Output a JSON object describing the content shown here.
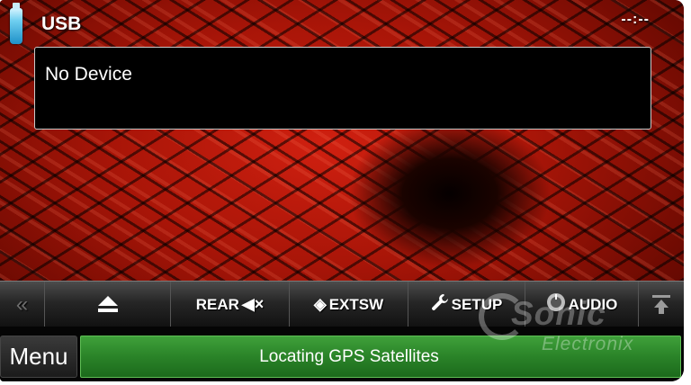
{
  "status_bar": {
    "source": "USB",
    "clock": "--:--",
    "source_icon": "usb-stick-icon"
  },
  "info_panel": {
    "device_status": "No Device"
  },
  "toolbar": {
    "prev_icon": "double-chevron-left-icon",
    "prev_glyph": "«",
    "eject_icon": "eject-icon",
    "rear_label": "REAR",
    "rear_icon": "speaker-mute-icon",
    "rear_glyph": "◀×",
    "extsw_label": "EXTSW",
    "extsw_icon": "extsw-icon",
    "extsw_glyph": "◈",
    "setup_label": "SETUP",
    "setup_icon": "wrench-icon",
    "setup_glyph": "🔧",
    "audio_label": "AUDIO",
    "audio_icon": "audio-knob-icon",
    "audio_glyph": "◉",
    "up_icon": "arrow-up-icon"
  },
  "bottom_bar": {
    "menu_label": "Menu",
    "gps_status": "Locating GPS Satellites"
  },
  "watermark": {
    "brand": "Sonic",
    "sub": "Electronix"
  },
  "colors": {
    "gps_bar": "#2a8328",
    "wallpaper": "#b81a0c",
    "usb_icon": "#6fcff0"
  }
}
